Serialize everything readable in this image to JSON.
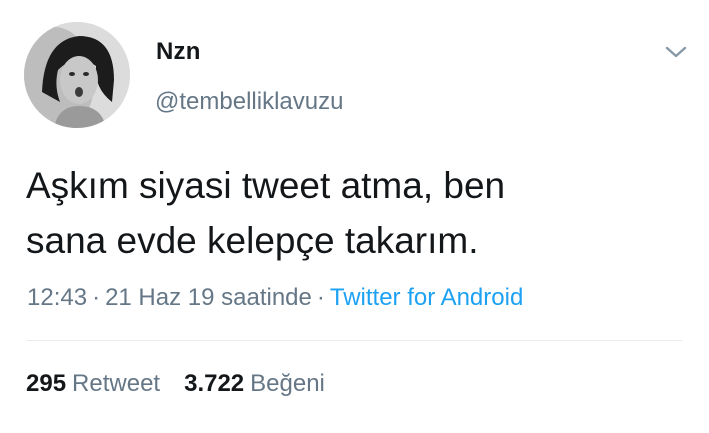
{
  "author": {
    "display_name": "Nzn",
    "username": "@tembelliklavuzu",
    "avatar_icon": "profile-photo"
  },
  "menu": {
    "icon": "chevron-down-icon"
  },
  "tweet": {
    "text": "Aşkım siyasi tweet atma, ben\nsana evde kelepçe takarım."
  },
  "meta": {
    "time": "12:43",
    "separator": "·",
    "date": "21 Haz 19 saatinde",
    "source": "Twitter for Android"
  },
  "stats": {
    "retweets": {
      "count": "295",
      "label": "Retweet"
    },
    "likes": {
      "count": "3.722",
      "label": "Beğeni"
    }
  },
  "colors": {
    "text": "#14171a",
    "muted": "#657786",
    "link": "#1da1f2",
    "divider": "#e6ecf0"
  }
}
